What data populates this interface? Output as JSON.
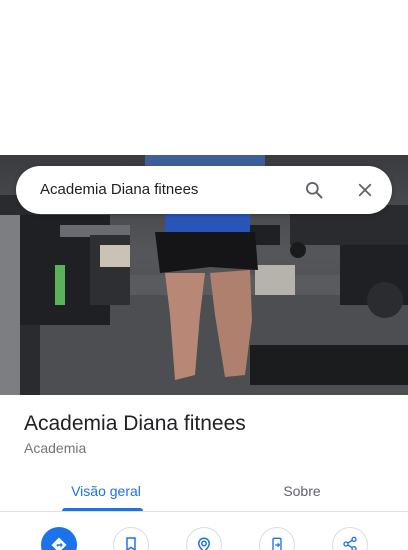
{
  "search": {
    "query": "Academia Diana fitnees",
    "search_icon": "search-icon",
    "close_icon": "close-icon"
  },
  "photo": {
    "description_icon": "gym-photo"
  },
  "place": {
    "name": "Academia Diana fitnees",
    "category": "Academia"
  },
  "tabs": [
    {
      "label": "Visão geral",
      "active": true
    },
    {
      "label": "Sobre",
      "active": false
    }
  ],
  "actions": [
    {
      "icon": "directions-icon"
    },
    {
      "icon": "bookmark-icon"
    },
    {
      "icon": "nearby-icon"
    },
    {
      "icon": "send-to-phone-icon"
    },
    {
      "icon": "share-icon"
    }
  ],
  "colors": {
    "accent": "#1a73e8",
    "title": "#202124",
    "secondary": "#70757a"
  }
}
